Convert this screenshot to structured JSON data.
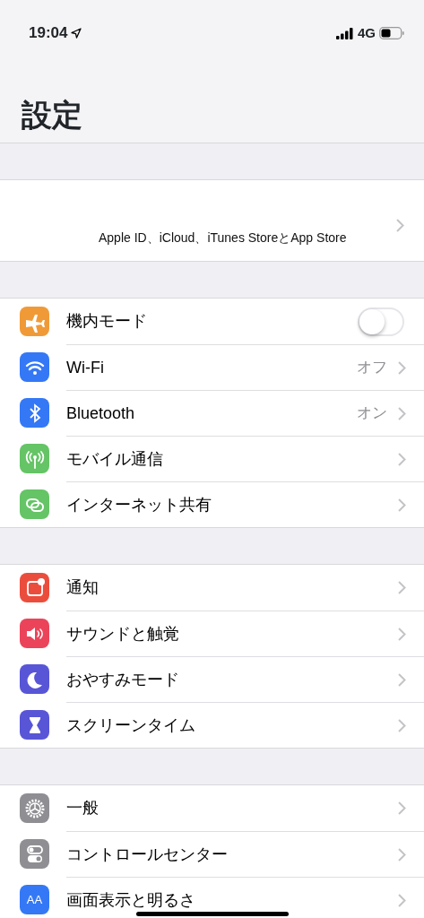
{
  "status_bar": {
    "time": "19:04",
    "network": "4G"
  },
  "title": "設定",
  "account": {
    "subtitle": "Apple ID、iCloud、iTunes StoreとApp Store"
  },
  "groups": [
    {
      "items": [
        {
          "label": "機内モード",
          "color": "#f09a37",
          "kind": "toggle",
          "on": false
        },
        {
          "label": "Wi-Fi",
          "color": "#3478f6",
          "kind": "link",
          "value": "オフ"
        },
        {
          "label": "Bluetooth",
          "color": "#3478f6",
          "kind": "link",
          "value": "オン"
        },
        {
          "label": "モバイル通信",
          "color": "#65c466",
          "kind": "link"
        },
        {
          "label": "インターネット共有",
          "color": "#65c466",
          "kind": "link"
        }
      ]
    },
    {
      "items": [
        {
          "label": "通知",
          "color": "#eb4d3d",
          "kind": "link"
        },
        {
          "label": "サウンドと触覚",
          "color": "#eb445a",
          "kind": "link"
        },
        {
          "label": "おやすみモード",
          "color": "#5856d6",
          "kind": "link"
        },
        {
          "label": "スクリーンタイム",
          "color": "#5856d6",
          "kind": "link"
        }
      ]
    },
    {
      "items": [
        {
          "label": "一般",
          "color": "#8e8e93",
          "kind": "link"
        },
        {
          "label": "コントロールセンター",
          "color": "#8e8e93",
          "kind": "link"
        },
        {
          "label": "画面表示と明るさ",
          "icon_label": "AA",
          "color": "#3478f6",
          "kind": "link"
        }
      ]
    }
  ]
}
